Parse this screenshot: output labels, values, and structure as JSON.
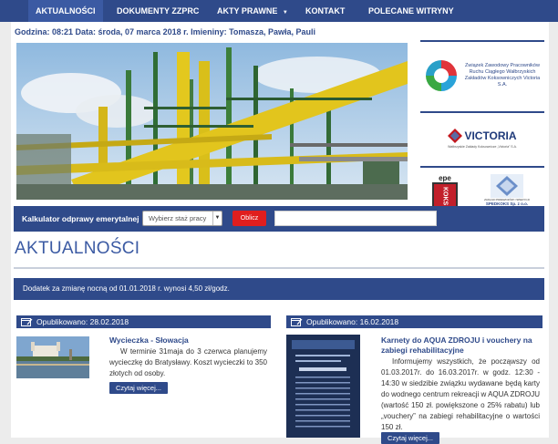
{
  "nav": {
    "items": [
      {
        "label": "AKTUALNOŚCI"
      },
      {
        "label": "DOKUMENTY ZZPRC"
      },
      {
        "label": "AKTY PRAWNE"
      },
      {
        "label": "KONTAKT"
      },
      {
        "label": "POLECANE WITRYNY"
      }
    ]
  },
  "info": "Godzina: 08:21   Data: środa, 07 marca 2018 r.   Imieniny: Tomasza, Pawła, Pauli",
  "sidebar": {
    "logo1_text": "Związek Zawodowy Pracowników Ruchu Ciągłego Wałbrzyskich Zakładów Koksowniczych Victoria S.A.",
    "logo2_text": "VICTORIA",
    "logo2_sub": "Wałbrzyskie Zakłady Koksownicze „Victoria” S.A.",
    "logo3_text": "epe",
    "logo3_sub": "KOKS",
    "logo4_text": "ZAKŁAD PRZEWOZÓW I SPEDYCJI",
    "logo4_sub": "SPEDKOKS Sp. z o.o."
  },
  "calculator": {
    "label": "Kalkulator odprawy emerytalnej",
    "select_value": "Wybierz staż pracy",
    "button": "Oblicz"
  },
  "heading": "AKTUALNOŚCI",
  "notice": "Dodatek za zmianę nocną od 01.01.2018 r. wynosi 4,50 zł/godz.",
  "articles": [
    {
      "published": "Opublikowano: 28.02.2018",
      "title": "Wycieczka - Słowacja",
      "body": "W terminie 31maja do 3 czerwca planujemy wycieczkę do Bratysławy. Koszt wycieczki to 350 złotych od osoby.",
      "more": "Czytaj więcej..."
    },
    {
      "published": "Opublikowano: 16.02.2018",
      "title": "Karnety do AQUA ZDROJU i vouchery na zabiegi rehabilitacyjne",
      "body": "Informujemy wszystkich, że począwszy od 01.03.2017r. do 16.03.2017r. w godz. 12:30 - 14:30 w siedzibie związku wydawane będą karty do wodnego centrum rekreacji w AQUA ZDROJU (wartość 150 zł. powiększone o 25% rabatu) lub „vouchery” na zabiegi rehabilitacyjne o wartości 150 zł.",
      "more": "Czytaj więcej..."
    }
  ],
  "colors": {
    "primary": "#2f4a8a",
    "accent": "#e01e1e"
  }
}
